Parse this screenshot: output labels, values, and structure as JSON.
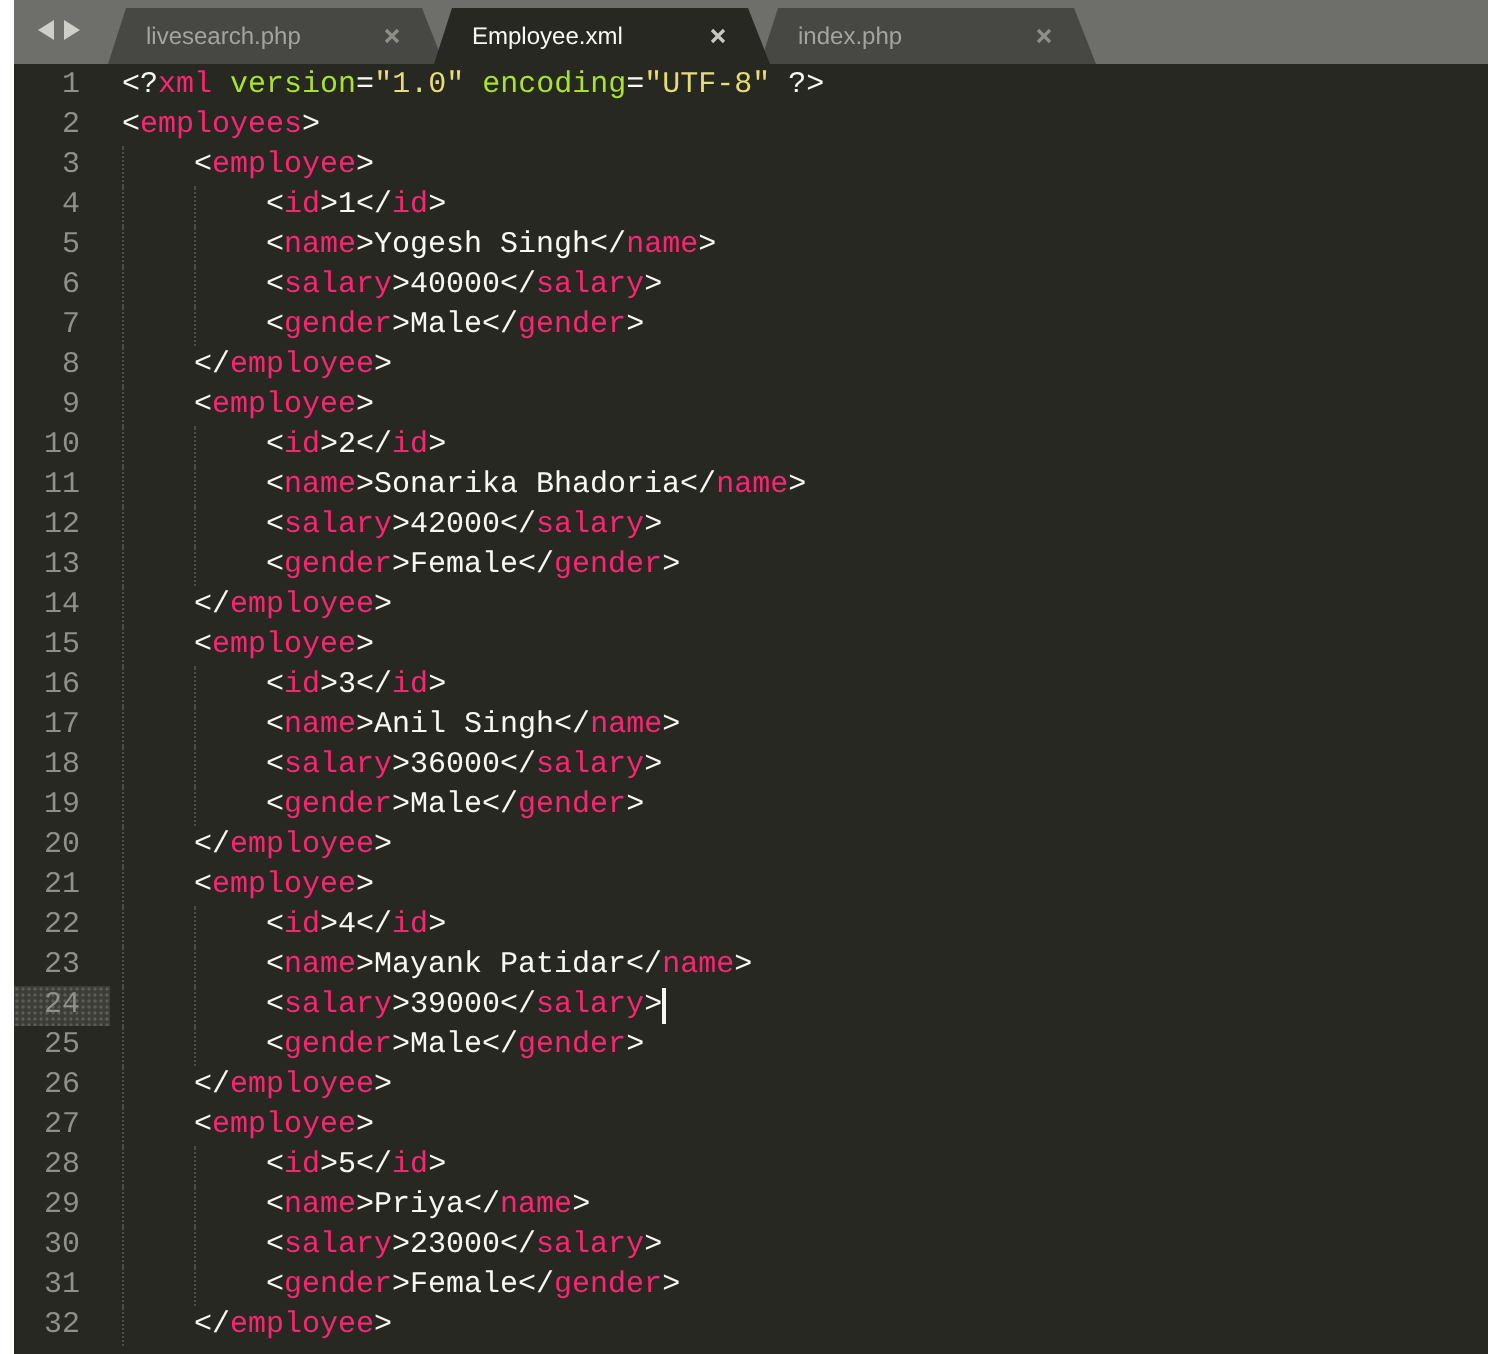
{
  "tabs": [
    {
      "label": "livesearch.php",
      "selected": false
    },
    {
      "label": "Employee.xml",
      "selected": true
    },
    {
      "label": "index.php",
      "selected": false
    }
  ],
  "editor": {
    "lines": [
      {
        "number": "1",
        "current": false,
        "tokens": [
          {
            "kind": "plain",
            "text": "<?"
          },
          {
            "kind": "tag",
            "text": "xml"
          },
          {
            "kind": "attr",
            "text": " version"
          },
          {
            "kind": "plain",
            "text": "="
          },
          {
            "kind": "string",
            "text": "\"1.0\""
          },
          {
            "kind": "attr",
            "text": " encoding"
          },
          {
            "kind": "plain",
            "text": "="
          },
          {
            "kind": "string",
            "text": "\"UTF-8\""
          },
          {
            "kind": "plain",
            "text": " ?>"
          }
        ]
      },
      {
        "number": "2",
        "current": false,
        "tokens": [
          {
            "kind": "plain",
            "text": "<"
          },
          {
            "kind": "tag",
            "text": "employees"
          },
          {
            "kind": "plain",
            "text": ">"
          }
        ],
        "children": [
          {
            "number": "3",
            "current": false,
            "tokens": [
              {
                "kind": "plain",
                "text": "<"
              },
              {
                "kind": "tag",
                "text": "employee"
              },
              {
                "kind": "plain",
                "text": ">"
              }
            ],
            "children": [
              {
                "number": "4",
                "current": false,
                "tokens": [
                  {
                    "kind": "plain",
                    "text": "<"
                  },
                  {
                    "kind": "tag",
                    "text": "id"
                  },
                  {
                    "kind": "plain",
                    "text": ">1</"
                  },
                  {
                    "kind": "tag",
                    "text": "id"
                  },
                  {
                    "kind": "plain",
                    "text": ">"
                  }
                ]
              },
              {
                "number": "5",
                "current": false,
                "tokens": [
                  {
                    "kind": "plain",
                    "text": "<"
                  },
                  {
                    "kind": "tag",
                    "text": "name"
                  },
                  {
                    "kind": "plain",
                    "text": ">Yogesh Singh</"
                  },
                  {
                    "kind": "tag",
                    "text": "name"
                  },
                  {
                    "kind": "plain",
                    "text": ">"
                  }
                ]
              },
              {
                "number": "6",
                "current": false,
                "tokens": [
                  {
                    "kind": "plain",
                    "text": "<"
                  },
                  {
                    "kind": "tag",
                    "text": "salary"
                  },
                  {
                    "kind": "plain",
                    "text": ">40000</"
                  },
                  {
                    "kind": "tag",
                    "text": "salary"
                  },
                  {
                    "kind": "plain",
                    "text": ">"
                  }
                ]
              },
              {
                "number": "7",
                "current": false,
                "tokens": [
                  {
                    "kind": "plain",
                    "text": "<"
                  },
                  {
                    "kind": "tag",
                    "text": "gender"
                  },
                  {
                    "kind": "plain",
                    "text": ">Male</"
                  },
                  {
                    "kind": "tag",
                    "text": "gender"
                  },
                  {
                    "kind": "plain",
                    "text": ">"
                  }
                ]
              }
            ]
          },
          {
            "number": "8",
            "current": false,
            "tokens": [
              {
                "kind": "plain",
                "text": "</"
              },
              {
                "kind": "tag",
                "text": "employee"
              },
              {
                "kind": "plain",
                "text": ">"
              }
            ]
          },
          {
            "number": "9",
            "current": false,
            "tokens": [
              {
                "kind": "plain",
                "text": "<"
              },
              {
                "kind": "tag",
                "text": "employee"
              },
              {
                "kind": "plain",
                "text": ">"
              }
            ],
            "children": [
              {
                "number": "10",
                "current": false,
                "tokens": [
                  {
                    "kind": "plain",
                    "text": "<"
                  },
                  {
                    "kind": "tag",
                    "text": "id"
                  },
                  {
                    "kind": "plain",
                    "text": ">2</"
                  },
                  {
                    "kind": "tag",
                    "text": "id"
                  },
                  {
                    "kind": "plain",
                    "text": ">"
                  }
                ]
              },
              {
                "number": "11",
                "current": false,
                "tokens": [
                  {
                    "kind": "plain",
                    "text": "<"
                  },
                  {
                    "kind": "tag",
                    "text": "name"
                  },
                  {
                    "kind": "plain",
                    "text": ">Sonarika Bhadoria</"
                  },
                  {
                    "kind": "tag",
                    "text": "name"
                  },
                  {
                    "kind": "plain",
                    "text": ">"
                  }
                ]
              },
              {
                "number": "12",
                "current": false,
                "tokens": [
                  {
                    "kind": "plain",
                    "text": "<"
                  },
                  {
                    "kind": "tag",
                    "text": "salary"
                  },
                  {
                    "kind": "plain",
                    "text": ">42000</"
                  },
                  {
                    "kind": "tag",
                    "text": "salary"
                  },
                  {
                    "kind": "plain",
                    "text": ">"
                  }
                ]
              },
              {
                "number": "13",
                "current": false,
                "tokens": [
                  {
                    "kind": "plain",
                    "text": "<"
                  },
                  {
                    "kind": "tag",
                    "text": "gender"
                  },
                  {
                    "kind": "plain",
                    "text": ">Female</"
                  },
                  {
                    "kind": "tag",
                    "text": "gender"
                  },
                  {
                    "kind": "plain",
                    "text": ">"
                  }
                ]
              }
            ]
          },
          {
            "number": "14",
            "current": false,
            "tokens": [
              {
                "kind": "plain",
                "text": "</"
              },
              {
                "kind": "tag",
                "text": "employee"
              },
              {
                "kind": "plain",
                "text": ">"
              }
            ]
          },
          {
            "number": "15",
            "current": false,
            "tokens": [
              {
                "kind": "plain",
                "text": "<"
              },
              {
                "kind": "tag",
                "text": "employee"
              },
              {
                "kind": "plain",
                "text": ">"
              }
            ],
            "children": [
              {
                "number": "16",
                "current": false,
                "tokens": [
                  {
                    "kind": "plain",
                    "text": "<"
                  },
                  {
                    "kind": "tag",
                    "text": "id"
                  },
                  {
                    "kind": "plain",
                    "text": ">3</"
                  },
                  {
                    "kind": "tag",
                    "text": "id"
                  },
                  {
                    "kind": "plain",
                    "text": ">"
                  }
                ]
              },
              {
                "number": "17",
                "current": false,
                "tokens": [
                  {
                    "kind": "plain",
                    "text": "<"
                  },
                  {
                    "kind": "tag",
                    "text": "name"
                  },
                  {
                    "kind": "plain",
                    "text": ">Anil Singh</"
                  },
                  {
                    "kind": "tag",
                    "text": "name"
                  },
                  {
                    "kind": "plain",
                    "text": ">"
                  }
                ]
              },
              {
                "number": "18",
                "current": false,
                "tokens": [
                  {
                    "kind": "plain",
                    "text": "<"
                  },
                  {
                    "kind": "tag",
                    "text": "salary"
                  },
                  {
                    "kind": "plain",
                    "text": ">36000</"
                  },
                  {
                    "kind": "tag",
                    "text": "salary"
                  },
                  {
                    "kind": "plain",
                    "text": ">"
                  }
                ]
              },
              {
                "number": "19",
                "current": false,
                "tokens": [
                  {
                    "kind": "plain",
                    "text": "<"
                  },
                  {
                    "kind": "tag",
                    "text": "gender"
                  },
                  {
                    "kind": "plain",
                    "text": ">Male</"
                  },
                  {
                    "kind": "tag",
                    "text": "gender"
                  },
                  {
                    "kind": "plain",
                    "text": ">"
                  }
                ]
              }
            ]
          },
          {
            "number": "20",
            "current": false,
            "tokens": [
              {
                "kind": "plain",
                "text": "</"
              },
              {
                "kind": "tag",
                "text": "employee"
              },
              {
                "kind": "plain",
                "text": ">"
              }
            ]
          },
          {
            "number": "21",
            "current": false,
            "tokens": [
              {
                "kind": "plain",
                "text": "<"
              },
              {
                "kind": "tag",
                "text": "employee"
              },
              {
                "kind": "plain",
                "text": ">"
              }
            ],
            "children": [
              {
                "number": "22",
                "current": false,
                "tokens": [
                  {
                    "kind": "plain",
                    "text": "<"
                  },
                  {
                    "kind": "tag",
                    "text": "id"
                  },
                  {
                    "kind": "plain",
                    "text": ">4</"
                  },
                  {
                    "kind": "tag",
                    "text": "id"
                  },
                  {
                    "kind": "plain",
                    "text": ">"
                  }
                ]
              },
              {
                "number": "23",
                "current": false,
                "tokens": [
                  {
                    "kind": "plain",
                    "text": "<"
                  },
                  {
                    "kind": "tag",
                    "text": "name"
                  },
                  {
                    "kind": "plain",
                    "text": ">Mayank Patidar</"
                  },
                  {
                    "kind": "tag",
                    "text": "name"
                  },
                  {
                    "kind": "plain",
                    "text": ">"
                  }
                ]
              },
              {
                "number": "24",
                "current": true,
                "tokens": [
                  {
                    "kind": "plain",
                    "text": "<"
                  },
                  {
                    "kind": "tag",
                    "text": "salary"
                  },
                  {
                    "kind": "plain",
                    "text": ">39000</"
                  },
                  {
                    "kind": "tag",
                    "text": "salary"
                  },
                  {
                    "kind": "plain",
                    "text": ">"
                  }
                ]
              },
              {
                "number": "25",
                "current": false,
                "tokens": [
                  {
                    "kind": "plain",
                    "text": "<"
                  },
                  {
                    "kind": "tag",
                    "text": "gender"
                  },
                  {
                    "kind": "plain",
                    "text": ">Male</"
                  },
                  {
                    "kind": "tag",
                    "text": "gender"
                  },
                  {
                    "kind": "plain",
                    "text": ">"
                  }
                ]
              }
            ]
          },
          {
            "number": "26",
            "current": false,
            "tokens": [
              {
                "kind": "plain",
                "text": "</"
              },
              {
                "kind": "tag",
                "text": "employee"
              },
              {
                "kind": "plain",
                "text": ">"
              }
            ]
          },
          {
            "number": "27",
            "current": false,
            "tokens": [
              {
                "kind": "plain",
                "text": "<"
              },
              {
                "kind": "tag",
                "text": "employee"
              },
              {
                "kind": "plain",
                "text": ">"
              }
            ],
            "children": [
              {
                "number": "28",
                "current": false,
                "tokens": [
                  {
                    "kind": "plain",
                    "text": "<"
                  },
                  {
                    "kind": "tag",
                    "text": "id"
                  },
                  {
                    "kind": "plain",
                    "text": ">5</"
                  },
                  {
                    "kind": "tag",
                    "text": "id"
                  },
                  {
                    "kind": "plain",
                    "text": ">"
                  }
                ]
              },
              {
                "number": "29",
                "current": false,
                "tokens": [
                  {
                    "kind": "plain",
                    "text": "<"
                  },
                  {
                    "kind": "tag",
                    "text": "name"
                  },
                  {
                    "kind": "plain",
                    "text": ">Priya</"
                  },
                  {
                    "kind": "tag",
                    "text": "name"
                  },
                  {
                    "kind": "plain",
                    "text": ">"
                  }
                ]
              },
              {
                "number": "30",
                "current": false,
                "tokens": [
                  {
                    "kind": "plain",
                    "text": "<"
                  },
                  {
                    "kind": "tag",
                    "text": "salary"
                  },
                  {
                    "kind": "plain",
                    "text": ">23000</"
                  },
                  {
                    "kind": "tag",
                    "text": "salary"
                  },
                  {
                    "kind": "plain",
                    "text": ">"
                  }
                ]
              },
              {
                "number": "31",
                "current": false,
                "tokens": [
                  {
                    "kind": "plain",
                    "text": "<"
                  },
                  {
                    "kind": "tag",
                    "text": "gender"
                  },
                  {
                    "kind": "plain",
                    "text": ">Female</"
                  },
                  {
                    "kind": "tag",
                    "text": "gender"
                  },
                  {
                    "kind": "plain",
                    "text": ">"
                  }
                ]
              }
            ]
          },
          {
            "number": "32",
            "current": false,
            "tokens": [
              {
                "kind": "plain",
                "text": "</"
              },
              {
                "kind": "tag",
                "text": "employee"
              },
              {
                "kind": "plain",
                "text": ">"
              }
            ]
          }
        ]
      }
    ]
  }
}
